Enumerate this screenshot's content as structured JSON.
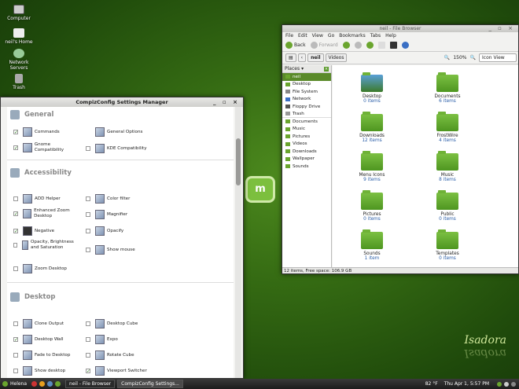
{
  "desktop_icons": [
    {
      "label": "Computer"
    },
    {
      "label": "neil's Home"
    },
    {
      "label": "Network Servers"
    },
    {
      "label": "Trash"
    }
  ],
  "ccsm": {
    "title": "CompizConfig Settings Manager",
    "categories": [
      {
        "name": "General",
        "plugins": [
          {
            "label": "Commands",
            "checked": true
          },
          {
            "label": "General Options",
            "checked": null
          },
          {
            "label": "Gnome Compatibility",
            "checked": true
          },
          {
            "label": "KDE Compatibility",
            "checked": false
          }
        ]
      },
      {
        "name": "Accessibility",
        "plugins": [
          {
            "label": "ADD Helper",
            "checked": false
          },
          {
            "label": "Color filter",
            "checked": false
          },
          {
            "label": "Enhanced Zoom Desktop",
            "checked": true
          },
          {
            "label": "Magnifier",
            "checked": false
          },
          {
            "label": "Negative",
            "checked": true
          },
          {
            "label": "Opacify",
            "checked": false
          },
          {
            "label": "Opacity, Brightness and Saturation",
            "checked": false
          },
          {
            "label": "Show mouse",
            "checked": false
          },
          {
            "label": "Zoom Desktop",
            "checked": false
          }
        ]
      },
      {
        "name": "Desktop",
        "plugins": [
          {
            "label": "Clone Output",
            "checked": false
          },
          {
            "label": "Desktop Cube",
            "checked": false
          },
          {
            "label": "Desktop Wall",
            "checked": true
          },
          {
            "label": "Expo",
            "checked": false
          },
          {
            "label": "Fade to Desktop",
            "checked": false
          },
          {
            "label": "Rotate Cube",
            "checked": false
          },
          {
            "label": "Show desktop",
            "checked": false
          },
          {
            "label": "Viewport Switcher",
            "checked": true
          }
        ]
      }
    ]
  },
  "fb": {
    "title": "neil - File Browser",
    "menu": [
      "File",
      "Edit",
      "View",
      "Go",
      "Bookmarks",
      "Tabs",
      "Help"
    ],
    "toolbar": {
      "back": "Back",
      "forward": "Forward"
    },
    "location": {
      "crumbs": [
        "neil",
        "Videos"
      ],
      "zoom": "150%",
      "view": "Icon View"
    },
    "places_label": "Places",
    "places": [
      "neil",
      "Desktop",
      "File System",
      "Network",
      "Floppy Drive",
      "Trash",
      "Documents",
      "Music",
      "Pictures",
      "Videos",
      "Downloads",
      "Wallpaper",
      "Sounds"
    ],
    "items": [
      {
        "name": "Desktop",
        "count": "0 items"
      },
      {
        "name": "Documents",
        "count": "6 items"
      },
      {
        "name": "Downloads",
        "count": "12 items"
      },
      {
        "name": "FrostWire",
        "count": "4 items"
      },
      {
        "name": "Menu Icons",
        "count": "9 items"
      },
      {
        "name": "Music",
        "count": "8 items"
      },
      {
        "name": "Pictures",
        "count": "0 items"
      },
      {
        "name": "Public",
        "count": "0 items"
      },
      {
        "name": "Sounds",
        "count": "1 item"
      },
      {
        "name": "Templates",
        "count": "0 items"
      }
    ],
    "status": "12 items, Free space: 106.9 GB"
  },
  "taskbar": {
    "user": "Helena",
    "tasks": [
      "neil - File Browser",
      "CompizConfig Settings..."
    ],
    "weather": "82 °F",
    "clock": "Thu Apr 1, 5:57 PM"
  },
  "signature": "Isadora"
}
